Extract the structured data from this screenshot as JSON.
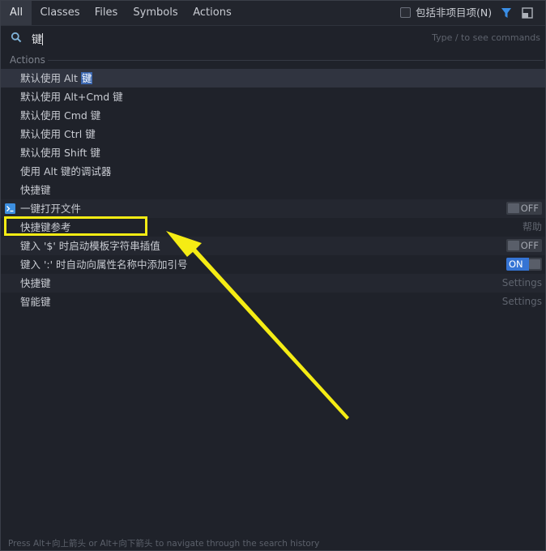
{
  "tabs": [
    {
      "label": "All",
      "active": true
    },
    {
      "label": "Classes"
    },
    {
      "label": "Files"
    },
    {
      "label": "Symbols"
    },
    {
      "label": "Actions"
    }
  ],
  "include_non_project": {
    "label": "包括非项目项(N)",
    "checked": false
  },
  "search": {
    "query": "键",
    "hint": "Type / to see commands"
  },
  "section": {
    "title": "Actions"
  },
  "rows": [
    {
      "label_prefix": "默认使用 Alt ",
      "label_match": "键"
    },
    {
      "label": "默认使用 Alt+Cmd 键"
    },
    {
      "label": "默认使用 Cmd 键"
    },
    {
      "label": "默认使用 Ctrl 键"
    },
    {
      "label": "默认使用 Shift 键"
    },
    {
      "label": "使用 Alt 键的调试器"
    },
    {
      "label": "快捷键"
    },
    {
      "label": "一键打开文件",
      "toggle": "OFF"
    },
    {
      "label": "快捷键参考",
      "right": "帮助"
    },
    {
      "label": "键入 '$' 时启动模板字符串插值",
      "toggle": "OFF"
    },
    {
      "label": "键入 ':' 时自动向属性名称中添加引号",
      "toggle": "ON"
    },
    {
      "label": "快捷键",
      "right": "Settings"
    },
    {
      "label": "智能键",
      "right": "Settings"
    }
  ],
  "footer": "Press Alt+向上箭头 or Alt+向下箭头 to navigate through the search history",
  "colors": {
    "accent": "#3574d4",
    "annotation": "#f5ec14",
    "background": "#1f222a"
  }
}
